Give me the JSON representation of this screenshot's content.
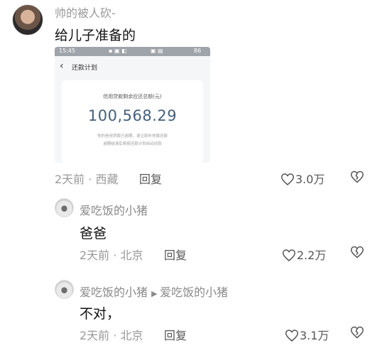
{
  "main_comment": {
    "author": "帅的被人砍-",
    "text": "给儿子准备的",
    "time": "2天前",
    "location": "西藏",
    "reply_label": "回复",
    "likes": "3.0万",
    "image": {
      "status_time": "15:45",
      "status_right": "86",
      "title": "还款计划",
      "balance_label": "信用贷款剩余应还总额(元)",
      "balance_value": "100,568.29",
      "note_line1": "你的信用贷款已逾期，请立即补充偿还款",
      "note_line2": "逾期结清后将按还款计划自动还款"
    }
  },
  "replies": [
    {
      "author": "爱吃饭的小猪",
      "text": "爸爸",
      "time": "2天前",
      "location": "北京",
      "reply_label": "回复",
      "likes": "2.2万"
    },
    {
      "author": "爱吃饭的小猪",
      "reply_to": "爱吃饭的小猪",
      "text": "不对，",
      "time": "2天前",
      "location": "北京",
      "reply_label": "回复",
      "likes": "3.1万"
    }
  ],
  "colors": {
    "amount": "#45607c",
    "meta": "#9a9a9a"
  }
}
